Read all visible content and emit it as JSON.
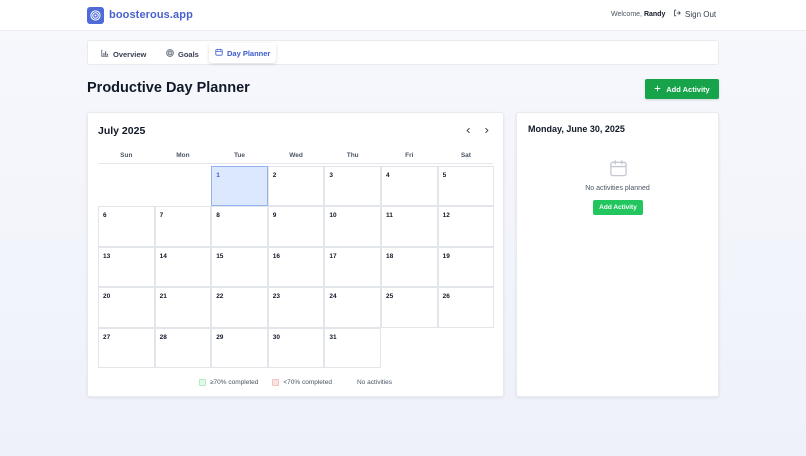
{
  "header": {
    "brand": "boosterous.app",
    "welcome_prefix": "Welcome,",
    "username": "Randy",
    "sign_out_label": "Sign Out"
  },
  "tabs": [
    {
      "label": "Overview",
      "icon": "bar-chart-icon",
      "active": false
    },
    {
      "label": "Goals",
      "icon": "target-icon",
      "active": false
    },
    {
      "label": "Day Planner",
      "icon": "calendar-icon",
      "active": true
    }
  ],
  "page": {
    "title": "Productive Day Planner",
    "add_activity_label": "Add Activity"
  },
  "calendar": {
    "month_label": "July 2025",
    "weekdays": [
      "Sun",
      "Mon",
      "Tue",
      "Wed",
      "Thu",
      "Fri",
      "Sat"
    ],
    "first_weekday_index": 2,
    "days_in_month": 31,
    "highlighted_day": 1,
    "prev_icon": "chevron-left-icon",
    "next_icon": "chevron-right-icon",
    "legend": [
      {
        "label": "≥70% completed",
        "swatch": "green"
      },
      {
        "label": "<70% completed",
        "swatch": "red"
      },
      {
        "label": "No activities",
        "swatch": "none"
      }
    ]
  },
  "side_panel": {
    "date_label": "Monday, June 30, 2025",
    "empty_text": "No activities planned",
    "add_activity_label": "Add Activity"
  },
  "colors": {
    "brand": "#4a5fcc",
    "primary_green": "#16a34a",
    "today_bg": "#dbe8fd"
  }
}
